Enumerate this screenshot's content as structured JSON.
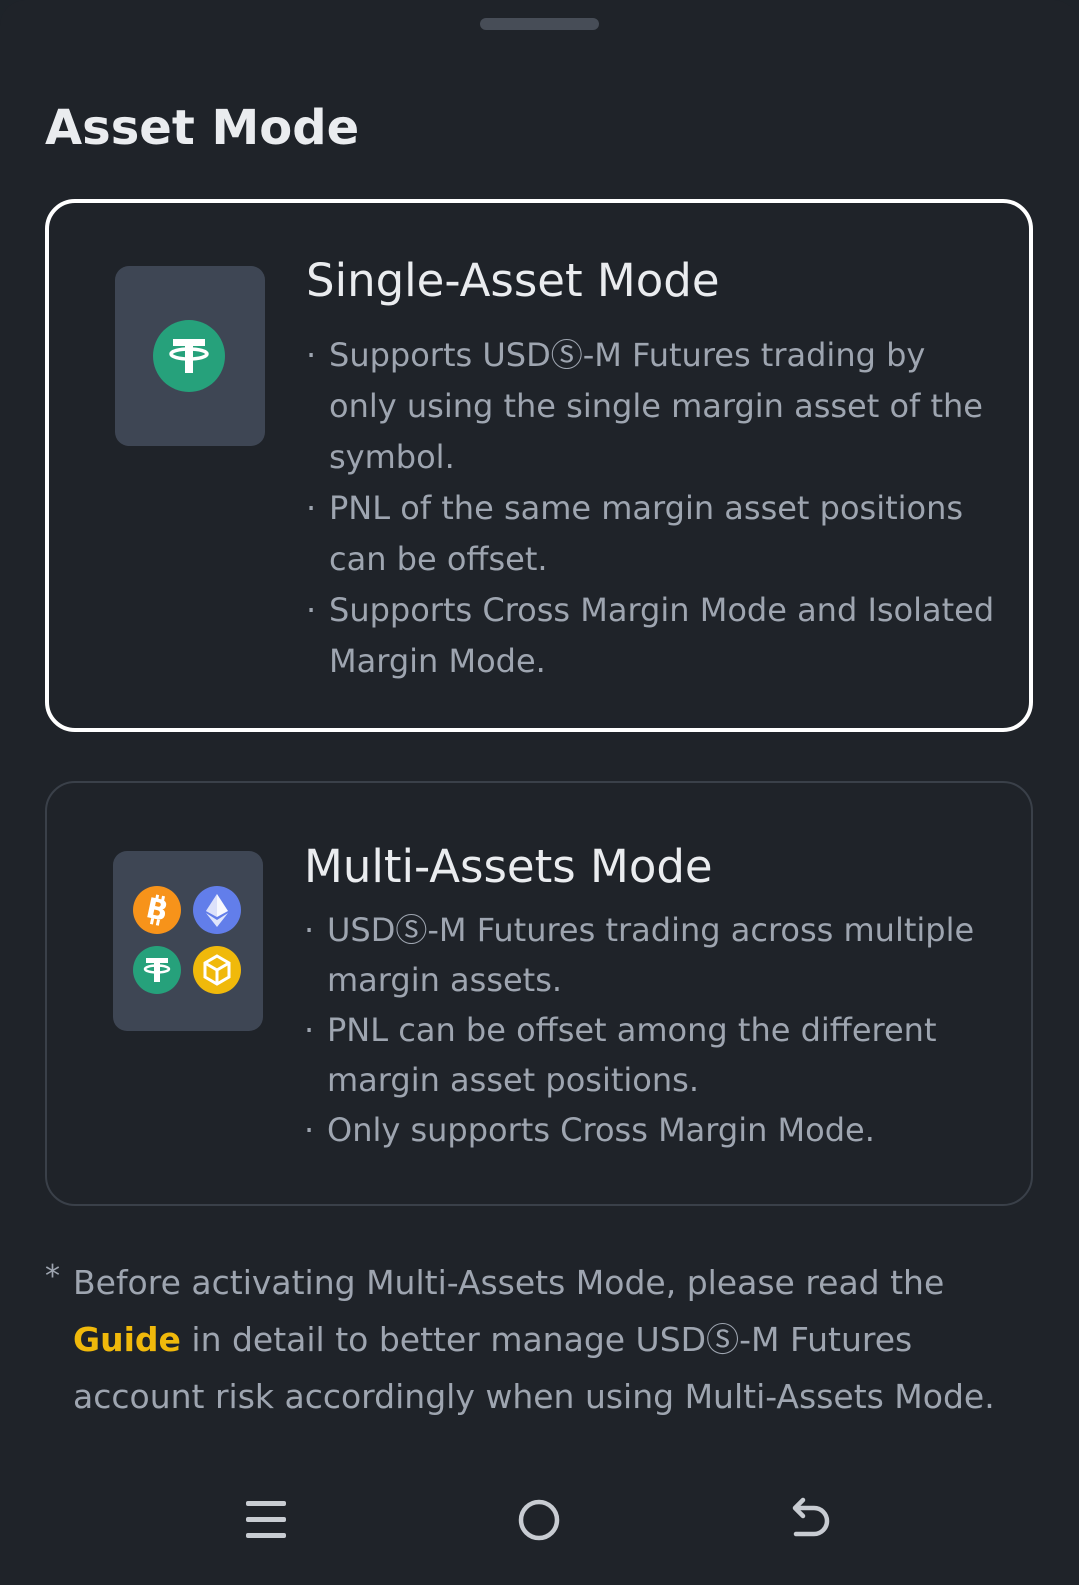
{
  "sheet": {
    "title": "Asset Mode"
  },
  "modes": [
    {
      "title": "Single-Asset Mode",
      "selected": true,
      "icons": [
        "usdt-icon"
      ],
      "bullets": [
        "Supports USDⓈ-M Futures trading by only using the single margin asset of the symbol.",
        "PNL of the same margin asset positions can be offset.",
        "Supports Cross Margin Mode and Isolated Margin Mode."
      ]
    },
    {
      "title": "Multi-Assets Mode",
      "selected": false,
      "icons": [
        "btc-icon",
        "eth-icon",
        "usdt-icon",
        "bnb-icon"
      ],
      "bullets": [
        "USDⓈ-M Futures trading across multiple margin assets.",
        "PNL can be offset among the different margin asset positions.",
        "Only supports Cross Margin Mode."
      ]
    }
  ],
  "note": {
    "marker": "*",
    "text_before": "Before activating Multi-Assets Mode, please read the ",
    "link": "Guide",
    "text_after": " in detail to better manage USDⓈ-M Futures account risk accordingly when using Multi-Assets Mode."
  },
  "colors": {
    "background": "#1f2329",
    "accent": "#f0b90b",
    "usdt": "#26a17b",
    "btc": "#f7931a",
    "eth": "#627eea",
    "bnb": "#f0b90b"
  },
  "navbar": {
    "icons": [
      "menu-icon",
      "home-icon",
      "back-icon"
    ]
  }
}
